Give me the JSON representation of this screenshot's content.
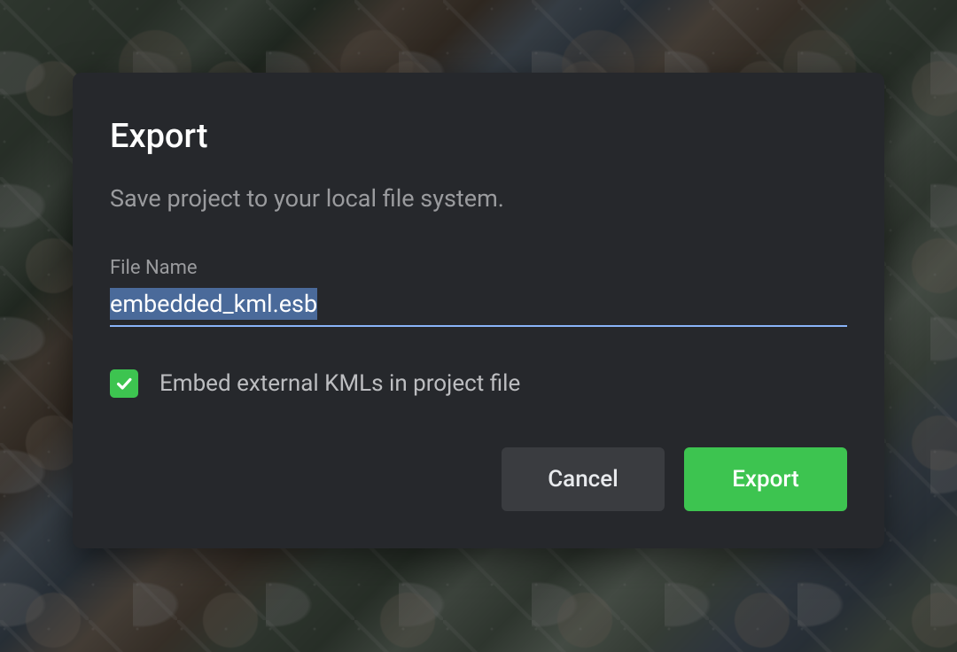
{
  "dialog": {
    "title": "Export",
    "subtitle": "Save project to your local file system.",
    "field_label": "File Name",
    "file_name_value": "embedded_kml.esb",
    "checkbox_label": "Embed external KMLs in project file",
    "checkbox_checked": true,
    "buttons": {
      "cancel": "Cancel",
      "export": "Export"
    },
    "colors": {
      "accent_green": "#3dc450",
      "accent_blue": "#8ab4f8",
      "dialog_bg": "#26282c"
    }
  }
}
